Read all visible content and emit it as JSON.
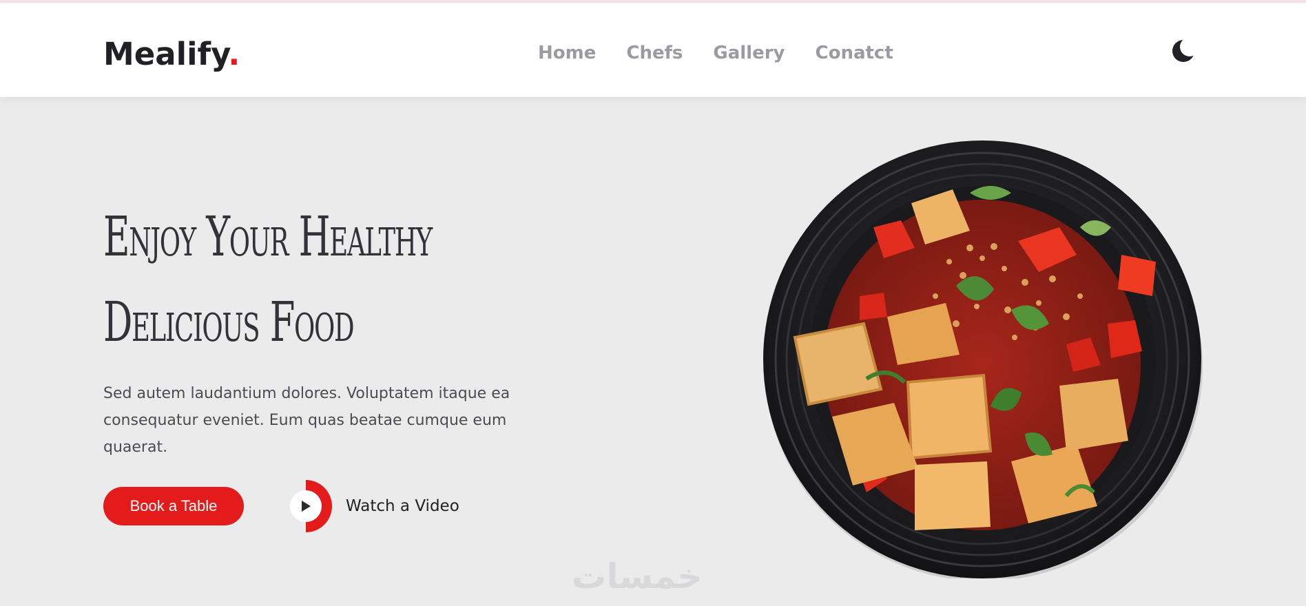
{
  "brand": {
    "name": "Mealify",
    "dot": ".",
    "accent": "#e31b1b"
  },
  "nav": {
    "items": [
      {
        "label": "Home"
      },
      {
        "label": "Chefs"
      },
      {
        "label": "Gallery"
      },
      {
        "label": "Conatct"
      }
    ]
  },
  "theme_toggle": {
    "icon": "moon-icon"
  },
  "hero": {
    "title_line1": "Enjoy Your Healthy",
    "title_line2": "Delicious Food",
    "description": "Sed autem laudantium dolores. Voluptatem itaque ea consequatur eveniet. Eum quas beatae cumque eum quaerat.",
    "book_label": "Book a Table",
    "watch_label": "Watch a Video",
    "image": "plate-of-food"
  },
  "watermark": "خمسات",
  "colors": {
    "background": "#ecebec",
    "header": "#ffffff",
    "nav_text": "#9a9aa2",
    "title_text": "#333238",
    "button": "#e31b1b"
  }
}
